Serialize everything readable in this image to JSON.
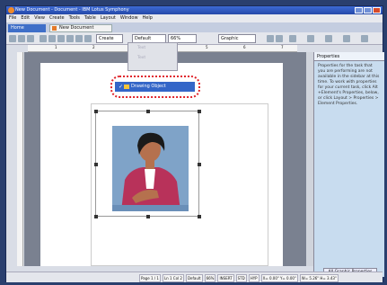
{
  "window": {
    "title": "New Document - Document - IBM Lotus Symphony"
  },
  "menu": [
    "File",
    "Edit",
    "View",
    "Create",
    "Tools",
    "Table",
    "Layout",
    "Window",
    "Help"
  ],
  "tabs": {
    "home": "Home",
    "document": "New Document"
  },
  "toolbar": {
    "style": "Default",
    "zoom": "66%",
    "font": "Graphic"
  },
  "dropdown": {
    "faint_item_1": "Text",
    "faint_item_2": "Text",
    "selected_item": "Drawing Object"
  },
  "ruler": [
    "1",
    "2",
    "3",
    "4",
    "5",
    "6",
    "7"
  ],
  "properties": {
    "title": "Properties",
    "text": "Properties for the task that you are performing are not available in the sidebar at this time. To work with properties for your current task, click Alt +Element's Properties, below, or click Layout > Properties > Element Properties.",
    "button": "All Graphic Properties"
  },
  "status": [
    "Page 1 / 1",
    "Ln 1 Col 2",
    "Default",
    "66%",
    "INSERT",
    "STD",
    "HYP",
    "X= 0.00\" Y= 0.00\"",
    "W= 5.26\" H= 3.43\""
  ]
}
